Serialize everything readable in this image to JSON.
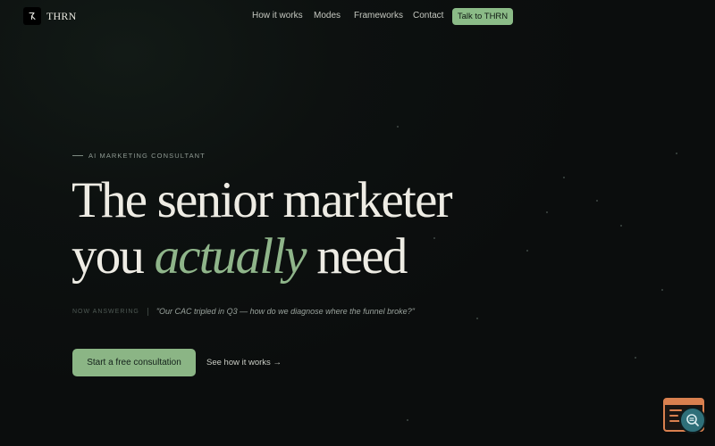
{
  "brand": {
    "logo_glyph": "R",
    "name": "THRN"
  },
  "nav": {
    "items": [
      {
        "label": "How it works"
      },
      {
        "label": "Modes"
      },
      {
        "label": "Frameworks"
      },
      {
        "label": "Contact"
      }
    ],
    "cta_label": "Talk to THRN"
  },
  "hero": {
    "eyebrow": "AI MARKETING CONSULTANT",
    "headline_line1": "The senior marketer",
    "headline_you": "you",
    "headline_accent": "actually",
    "headline_end": "need",
    "answer_label": "NOW ANSWERING",
    "answer_quote": "\"Our CAC tripled in Q3 — how do we diagnose where the funnel broke?\"",
    "primary_cta": "Start a free consultation",
    "secondary_cta": "See how it works →"
  },
  "colors": {
    "background": "#0c0e0e",
    "accent_green": "#8bb585",
    "accent_italic": "#8fb58a",
    "widget_orange": "#d9804f",
    "widget_teal": "#2e6f79"
  },
  "icons": {
    "logo": "logo-mark-icon",
    "widget": "terminal-window-icon",
    "widget_badge": "search-icon"
  }
}
